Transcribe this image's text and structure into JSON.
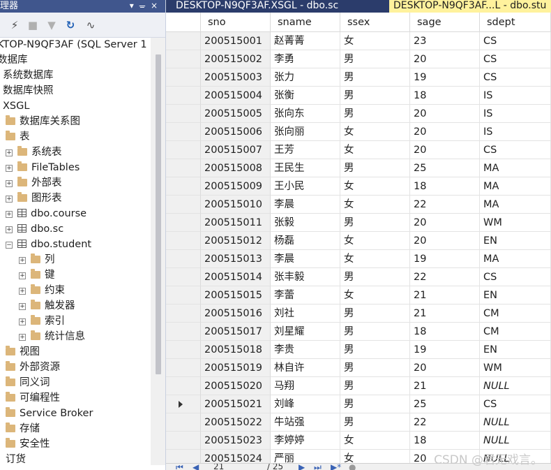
{
  "explorer": {
    "title": "理器",
    "toolbar_icons": [
      "connect-icon",
      "stop-icon",
      "filter-icon",
      "refresh-icon",
      "activity-monitor-icon"
    ],
    "nodes": [
      {
        "label": "KTOP-N9QF3AF (SQL Server 1",
        "type": "server"
      },
      {
        "label": "数据库",
        "type": "text"
      },
      {
        "label": "系统数据库",
        "type": "text"
      },
      {
        "label": "数据库快照",
        "type": "text"
      },
      {
        "label": "XSGL",
        "type": "text"
      },
      {
        "label": "数据库关系图",
        "type": "folder"
      },
      {
        "label": "表",
        "type": "folder"
      },
      {
        "label": "系统表",
        "type": "folder"
      },
      {
        "label": "FileTables",
        "type": "folder"
      },
      {
        "label": "外部表",
        "type": "folder"
      },
      {
        "label": "图形表",
        "type": "folder"
      },
      {
        "label": "dbo.course",
        "type": "table"
      },
      {
        "label": "dbo.sc",
        "type": "table"
      },
      {
        "label": "dbo.student",
        "type": "table"
      },
      {
        "label": "列",
        "type": "folder"
      },
      {
        "label": "键",
        "type": "folder"
      },
      {
        "label": "约束",
        "type": "folder"
      },
      {
        "label": "触发器",
        "type": "folder"
      },
      {
        "label": "索引",
        "type": "folder"
      },
      {
        "label": "统计信息",
        "type": "folder"
      },
      {
        "label": "视图",
        "type": "folder"
      },
      {
        "label": "外部资源",
        "type": "folder"
      },
      {
        "label": "同义词",
        "type": "folder"
      },
      {
        "label": "可编程性",
        "type": "folder"
      },
      {
        "label": "Service Broker",
        "type": "folder"
      },
      {
        "label": "存储",
        "type": "folder"
      },
      {
        "label": "安全性",
        "type": "folder"
      },
      {
        "label": "订货",
        "type": "text"
      }
    ]
  },
  "tabs": [
    {
      "label": "DESKTOP-N9QF3AF.XSGL - dbo.sc",
      "active": false
    },
    {
      "label": "DESKTOP-N9QF3AF...L - dbo.stu",
      "active": true
    }
  ],
  "grid": {
    "columns": [
      "sno",
      "sname",
      "ssex",
      "sage",
      "sdept"
    ],
    "rows": [
      [
        "200515001",
        "赵菁菁",
        "女",
        "23",
        "CS"
      ],
      [
        "200515002",
        "李勇",
        "男",
        "20",
        "CS"
      ],
      [
        "200515003",
        "张力",
        "男",
        "19",
        "CS"
      ],
      [
        "200515004",
        "张衡",
        "男",
        "18",
        "IS"
      ],
      [
        "200515005",
        "张向东",
        "男",
        "20",
        "IS"
      ],
      [
        "200515006",
        "张向丽",
        "女",
        "20",
        "IS"
      ],
      [
        "200515007",
        "王芳",
        "女",
        "20",
        "CS"
      ],
      [
        "200515008",
        "王民生",
        "男",
        "25",
        "MA"
      ],
      [
        "200515009",
        "王小民",
        "女",
        "18",
        "MA"
      ],
      [
        "200515010",
        "李晨",
        "女",
        "22",
        "MA"
      ],
      [
        "200515011",
        "张毅",
        "男",
        "20",
        "WM"
      ],
      [
        "200515012",
        "杨磊",
        "女",
        "20",
        "EN"
      ],
      [
        "200515013",
        "李晨",
        "女",
        "19",
        "MA"
      ],
      [
        "200515014",
        "张丰毅",
        "男",
        "22",
        "CS"
      ],
      [
        "200515015",
        "李蕾",
        "女",
        "21",
        "EN"
      ],
      [
        "200515016",
        "刘社",
        "男",
        "21",
        "CM"
      ],
      [
        "200515017",
        "刘星耀",
        "男",
        "18",
        "CM"
      ],
      [
        "200515018",
        "李贵",
        "男",
        "19",
        "EN"
      ],
      [
        "200515019",
        "林自许",
        "男",
        "20",
        "WM"
      ],
      [
        "200515020",
        "马翔",
        "男",
        "21",
        "NULL"
      ],
      [
        "200515021",
        "刘峰",
        "男",
        "25",
        "CS"
      ],
      [
        "200515022",
        "牛站强",
        "男",
        "22",
        "NULL"
      ],
      [
        "200515023",
        "李婷婷",
        "女",
        "18",
        "NULL"
      ],
      [
        "200515024",
        "严丽",
        "女",
        "20",
        "NULL"
      ]
    ],
    "current_row": 21
  },
  "navigator": {
    "position": "21",
    "total": "/ 25"
  },
  "watermark": "CSDN @君无戏言。",
  "colors": {
    "title_bar": "#40568d",
    "tab_bar": "#2b3c6b",
    "active_tab": "#fff29d",
    "folder": "#dcb67a"
  }
}
